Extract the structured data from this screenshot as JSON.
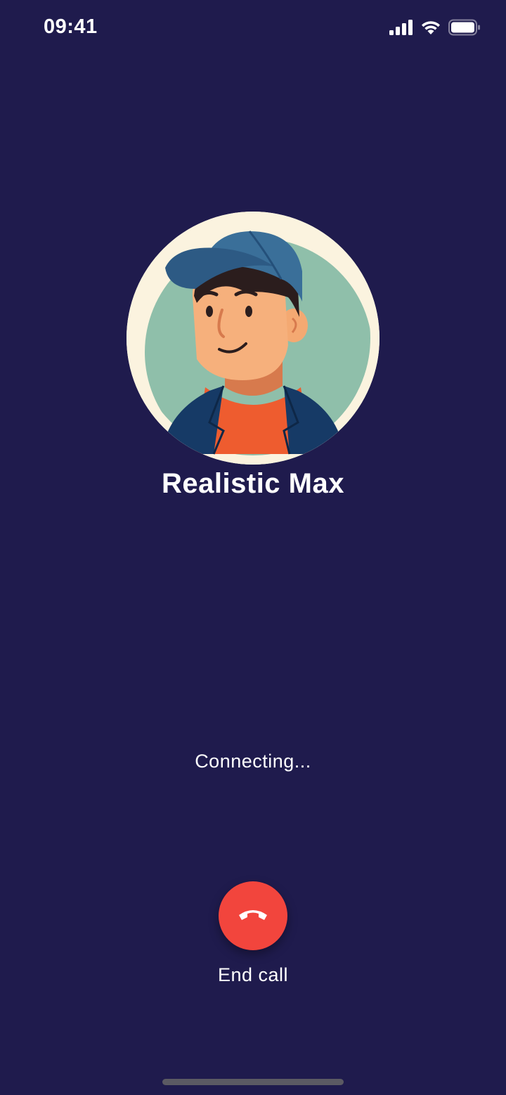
{
  "status_bar": {
    "time": "09:41",
    "icons": [
      "cellular-signal-icon",
      "wifi-icon",
      "battery-icon"
    ]
  },
  "call": {
    "caller_name": "Realistic Max",
    "status_text": "Connecting...",
    "end_call_label": "End call",
    "end_call_icon": "phone-hangup-icon"
  },
  "colors": {
    "background": "#1f1b4d",
    "end_call": "#f2453d",
    "avatar_ring": "#fbf3df",
    "avatar_backdrop": "#8fbfaa"
  }
}
